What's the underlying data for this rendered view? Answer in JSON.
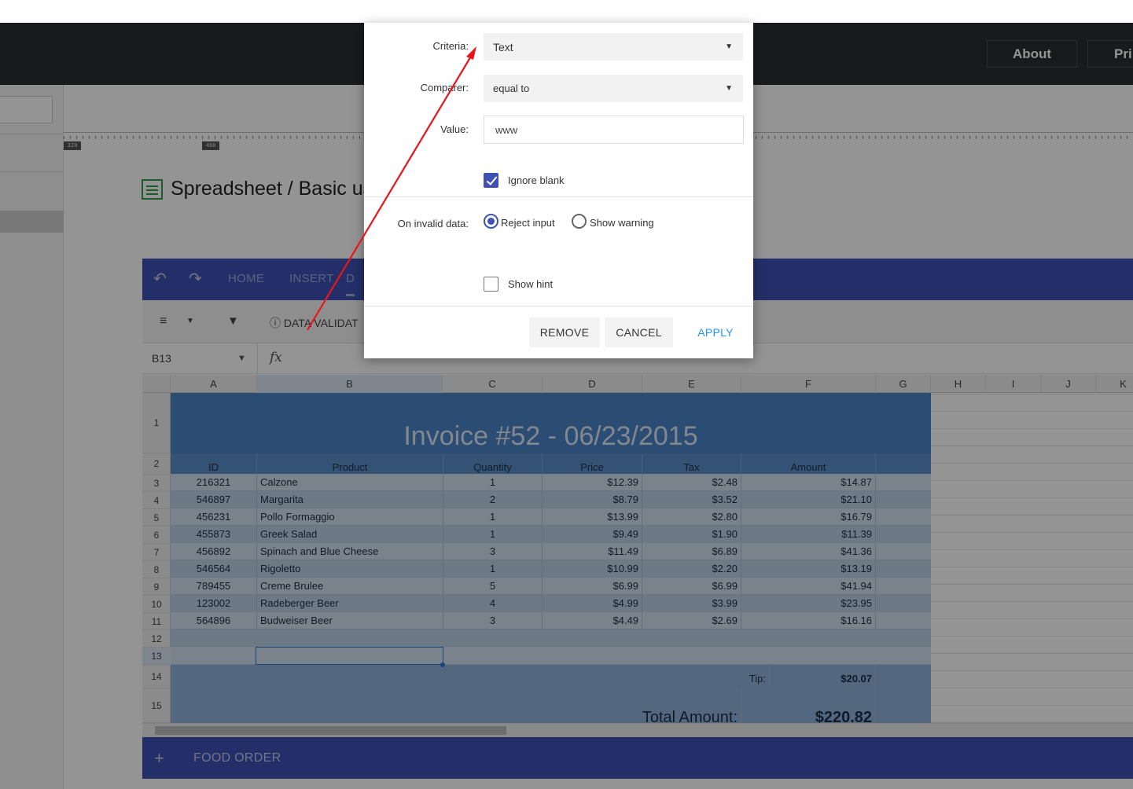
{
  "topnav": {
    "about_label": "About",
    "pricing_label": "Pri"
  },
  "ruler": {
    "tag1": "320",
    "tag2": "480"
  },
  "page": {
    "title": "Spreadsheet / Basic us"
  },
  "spreadsheet": {
    "tabs": [
      "HOME",
      "INSERT",
      "D"
    ],
    "ribbon": {
      "data_validation_label": "DATA VALIDAT"
    },
    "namebox": "B13",
    "fx_label": "fx",
    "columns": [
      "A",
      "B",
      "C",
      "D",
      "E",
      "F",
      "G",
      "H",
      "I",
      "J",
      "K"
    ],
    "row_numbers": [
      "1",
      "2",
      "3",
      "4",
      "5",
      "6",
      "7",
      "8",
      "9",
      "10",
      "11",
      "12",
      "13",
      "14",
      "15"
    ],
    "invoice_title": "Invoice #52 - 06/23/2015",
    "headers": [
      "ID",
      "Product",
      "Quantity",
      "Price",
      "Tax",
      "Amount"
    ],
    "rows": [
      [
        "216321",
        "Calzone",
        "1",
        "$12.39",
        "$2.48",
        "$14.87"
      ],
      [
        "546897",
        "Margarita",
        "2",
        "$8.79",
        "$3.52",
        "$21.10"
      ],
      [
        "456231",
        "Pollo Formaggio",
        "1",
        "$13.99",
        "$2.80",
        "$16.79"
      ],
      [
        "455873",
        "Greek Salad",
        "1",
        "$9.49",
        "$1.90",
        "$11.39"
      ],
      [
        "456892",
        "Spinach and Blue Cheese",
        "3",
        "$11.49",
        "$6.89",
        "$41.36"
      ],
      [
        "546564",
        "Rigoletto",
        "1",
        "$10.99",
        "$2.20",
        "$13.19"
      ],
      [
        "789455",
        "Creme Brulee",
        "5",
        "$6.99",
        "$6.99",
        "$41.94"
      ],
      [
        "123002",
        "Radeberger Beer",
        "4",
        "$4.99",
        "$3.99",
        "$23.95"
      ],
      [
        "564896",
        "Budweiser Beer",
        "3",
        "$4.49",
        "$2.69",
        "$16.16"
      ]
    ],
    "tip_label": "Tip:",
    "tip_value": "$20.07",
    "total_label": "Total Amount:",
    "total_value": "$220.82",
    "sheet_add": "+",
    "sheet_name": "FOOD ORDER"
  },
  "dialog": {
    "criteria_label": "Criteria:",
    "criteria_value": "Text",
    "comparer_label": "Comparer:",
    "comparer_value": "equal to",
    "value_label": "Value:",
    "value_text": "www",
    "ignore_blank_label": "Ignore blank",
    "ignore_blank_checked": true,
    "invalid_label": "On invalid data:",
    "reject_label": "Reject input",
    "warning_label": "Show warning",
    "selected_option": "Reject input",
    "show_hint_label": "Show hint",
    "show_hint_checked": false,
    "remove_label": "REMOVE",
    "cancel_label": "CANCEL",
    "apply_label": "APPLY"
  },
  "colors": {
    "accent": "#3f51b5",
    "apply_text": "#2196f3",
    "annotation_arrow": "#e8161b",
    "invoice_header": "#4a86c8"
  }
}
